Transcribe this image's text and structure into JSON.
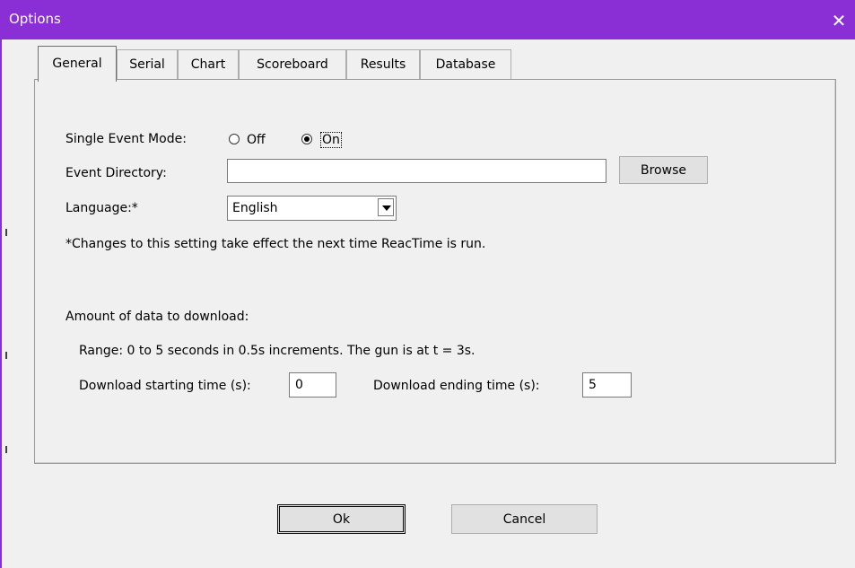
{
  "window": {
    "title": "Options",
    "close_glyph": "✕"
  },
  "tabs": [
    {
      "label": "General",
      "active": true
    },
    {
      "label": "Serial",
      "active": false
    },
    {
      "label": "Chart",
      "active": false
    },
    {
      "label": "Scoreboard",
      "active": false
    },
    {
      "label": "Results",
      "active": false
    },
    {
      "label": "Database",
      "active": false
    }
  ],
  "general": {
    "single_event_mode": {
      "label": "Single Event Mode:",
      "option_off": "Off",
      "option_on": "On",
      "selected": "On"
    },
    "event_directory": {
      "label": "Event Directory:",
      "value": "",
      "browse_label": "Browse"
    },
    "language": {
      "label": "Language:*",
      "value": "English"
    },
    "language_note": "*Changes to this setting take effect the next time ReacTime is run.",
    "download": {
      "heading": "Amount of data to download:",
      "range_note": "Range: 0 to 5 seconds in 0.5s increments.  The gun is at t = 3s.",
      "start_label": "Download starting time (s):",
      "start_value": "0",
      "end_label": "Download ending time (s):",
      "end_value": "5"
    }
  },
  "footer": {
    "ok_label": "Ok",
    "cancel_label": "Cancel"
  },
  "colors": {
    "titlebar": "#8a2ed6",
    "window_bg": "#f0f0f0"
  }
}
